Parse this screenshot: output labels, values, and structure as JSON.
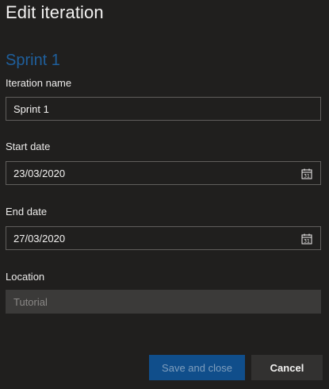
{
  "dialog": {
    "title": "Edit iteration",
    "heading": "Sprint 1"
  },
  "fields": {
    "iteration_name": {
      "label": "Iteration name",
      "value": "Sprint 1"
    },
    "start_date": {
      "label": "Start date",
      "value": "23/03/2020",
      "icon": "calendar-icon"
    },
    "end_date": {
      "label": "End date",
      "value": "27/03/2020",
      "icon": "calendar-icon"
    },
    "location": {
      "label": "Location",
      "value": "Tutorial",
      "disabled": true
    }
  },
  "actions": {
    "save_label": "Save and close",
    "cancel_label": "Cancel"
  },
  "colors": {
    "background": "#201f1e",
    "accent": "#104e8b",
    "heading": "#1f5f9c"
  }
}
